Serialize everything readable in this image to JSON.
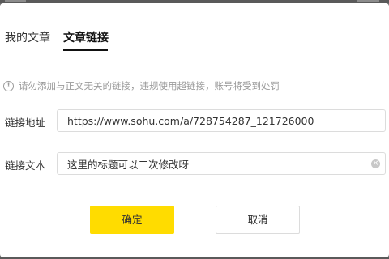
{
  "tabs": [
    {
      "label": "我的文章",
      "active": false
    },
    {
      "label": "文章链接",
      "active": true
    }
  ],
  "notice": {
    "icon": "info-icon",
    "icon_glyph": "!",
    "text": "请勿添加与正文无关的链接，违规使用超链接，账号将受到处罚"
  },
  "form": {
    "url_label": "链接地址",
    "url_value": "https://www.sohu.com/a/728754287_121726000",
    "text_label": "链接文本",
    "text_value": "这里的标题可以二次修改呀",
    "clear_icon": "clear-icon",
    "clear_glyph": "×"
  },
  "buttons": {
    "ok_label": "确定",
    "cancel_label": "取消"
  },
  "colors": {
    "primary_button": "#ffdc00",
    "overlay": "#6e6e6e"
  }
}
